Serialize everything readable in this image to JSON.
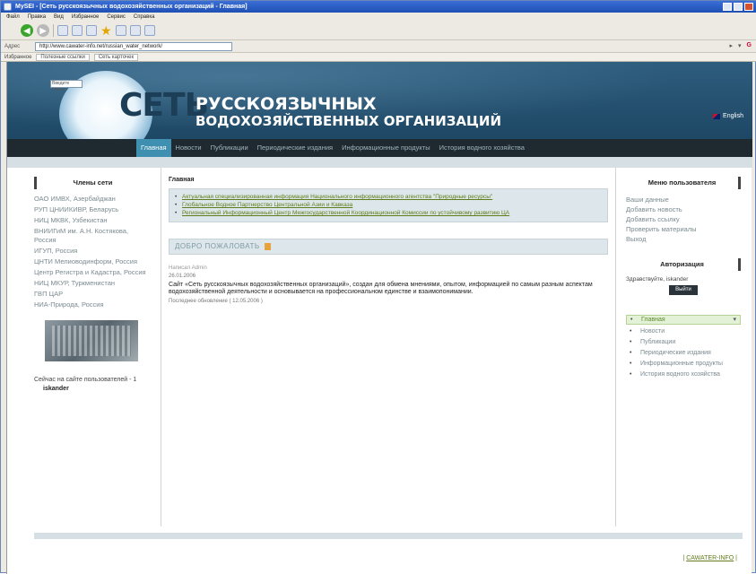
{
  "window": {
    "title": "MySEI - [Сеть русскоязычных водохозяйственных организаций - Главная]"
  },
  "menubar": [
    "Файл",
    "Правка",
    "Вид",
    "Избранное",
    "Сервис",
    "Справка"
  ],
  "address": {
    "label": "Адрес",
    "url": "http://www.cawater-info.net/russian_water_network/"
  },
  "favorites": [
    "Избранное",
    "Полезные ссылки",
    "Сеть карточек"
  ],
  "header": {
    "search_placeholder": "Введите слово",
    "logo": "СЕТЬ",
    "title_line1": "РУССКОЯЗЫЧНЫХ",
    "title_line2": "ВОДОХОЗЯЙСТВЕННЫХ ОРГАНИЗАЦИЙ",
    "language": "English"
  },
  "nav": [
    {
      "label": "Главная",
      "active": true
    },
    {
      "label": "Новости",
      "active": false
    },
    {
      "label": "Публикации",
      "active": false
    },
    {
      "label": "Периодические издания",
      "active": false
    },
    {
      "label": "Информационные продукты",
      "active": false
    },
    {
      "label": "История водного хозяйства",
      "active": false
    }
  ],
  "left": {
    "heading": "Члены сети",
    "members": [
      "ОАО ИМВХ, Азербайджан",
      "РУП ЦНИИКИВР, Беларусь",
      "НИЦ МКВК, Узбекистан",
      "ВНИИГиМ им. А.Н. Костякова, Россия",
      "ИГУП, Россия",
      "ЦНТИ Мелиоводинформ, Россия",
      "Центр Регистра и Кадастра, Россия",
      "НИЦ МКУР, Туркменистан",
      "ГВП ЦАР",
      "НИА-Природа, Россия"
    ],
    "online_text": "Сейчас на сайте пользователей - 1",
    "online_user": "iskander"
  },
  "main": {
    "breadcrumb": "Главная",
    "news": [
      "Актуальная специализированная информация Национального информационного агентства \"Природные ресурсы\"",
      "Глобальное Водное Партнерство Центральной Азии и Кавказа",
      "Региональный Информационный Центр Межгосударственной Координационной Комиссии по устойчивому развитию ЦА"
    ],
    "welcome": "ДОБРО ПОЖАЛОВАТЬ",
    "author": "Написал Admin",
    "date": "26.01.2006",
    "body": "Сайт «Сеть русскоязычных водохозяйственных организаций», создан для обмена мнениями, опытом, информацией по самым разным аспектам водохозяйственной деятельности и основывается на профессиональном единстве и взаимопонимании.",
    "updated": "Последнее обновление ( 12.05.2006 )"
  },
  "right": {
    "heading": "Меню пользователя",
    "links": [
      "Ваши данные",
      "Добавить новость",
      "Добавить ссылку",
      "Проверить материалы",
      "Выход"
    ],
    "auth_heading": "Авторизация",
    "greeting": "Здравствуйте, iskander",
    "logout": "Выйти",
    "menu": [
      "Главная",
      "Новости",
      "Публикации",
      "Периодические издания",
      "Информационные продукты",
      "История водного хозяйства"
    ]
  },
  "footer": {
    "link": "CAWATER-INFO"
  }
}
